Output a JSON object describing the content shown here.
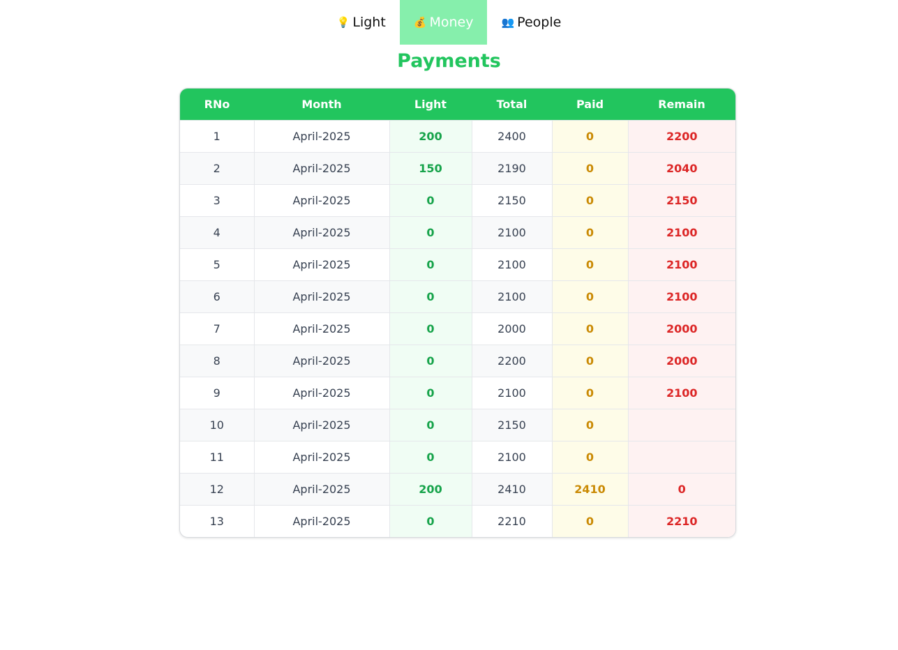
{
  "nav": {
    "items": [
      {
        "icon": "💡",
        "icon_name": "lightbulb-icon",
        "label": "Light",
        "active": false
      },
      {
        "icon": "💰",
        "icon_name": "money-bag-icon",
        "label": "Money",
        "active": true
      },
      {
        "icon": "👥",
        "icon_name": "people-icon",
        "label": "People",
        "active": false
      }
    ]
  },
  "page": {
    "title": "Payments"
  },
  "table": {
    "columns": [
      "RNo",
      "Month",
      "Light",
      "Total",
      "Paid",
      "Remain"
    ],
    "rows": [
      {
        "rno": "1",
        "month": "April-2025",
        "light": "200",
        "total": "2400",
        "paid": "0",
        "remain": "2200"
      },
      {
        "rno": "2",
        "month": "April-2025",
        "light": "150",
        "total": "2190",
        "paid": "0",
        "remain": "2040"
      },
      {
        "rno": "3",
        "month": "April-2025",
        "light": "0",
        "total": "2150",
        "paid": "0",
        "remain": "2150"
      },
      {
        "rno": "4",
        "month": "April-2025",
        "light": "0",
        "total": "2100",
        "paid": "0",
        "remain": "2100"
      },
      {
        "rno": "5",
        "month": "April-2025",
        "light": "0",
        "total": "2100",
        "paid": "0",
        "remain": "2100"
      },
      {
        "rno": "6",
        "month": "April-2025",
        "light": "0",
        "total": "2100",
        "paid": "0",
        "remain": "2100"
      },
      {
        "rno": "7",
        "month": "April-2025",
        "light": "0",
        "total": "2000",
        "paid": "0",
        "remain": "2000"
      },
      {
        "rno": "8",
        "month": "April-2025",
        "light": "0",
        "total": "2200",
        "paid": "0",
        "remain": "2000"
      },
      {
        "rno": "9",
        "month": "April-2025",
        "light": "0",
        "total": "2100",
        "paid": "0",
        "remain": "2100"
      },
      {
        "rno": "10",
        "month": "April-2025",
        "light": "0",
        "total": "2150",
        "paid": "0",
        "remain": ""
      },
      {
        "rno": "11",
        "month": "April-2025",
        "light": "0",
        "total": "2100",
        "paid": "0",
        "remain": ""
      },
      {
        "rno": "12",
        "month": "April-2025",
        "light": "200",
        "total": "2410",
        "paid": "2410",
        "remain": "0"
      },
      {
        "rno": "13",
        "month": "April-2025",
        "light": "0",
        "total": "2210",
        "paid": "0",
        "remain": "2210"
      }
    ]
  },
  "colors": {
    "accent": "#22c55e",
    "nav_active_bg": "#86efac",
    "light_text": "#16a34a",
    "paid_text": "#ca8a04",
    "remain_text": "#dc2626"
  }
}
